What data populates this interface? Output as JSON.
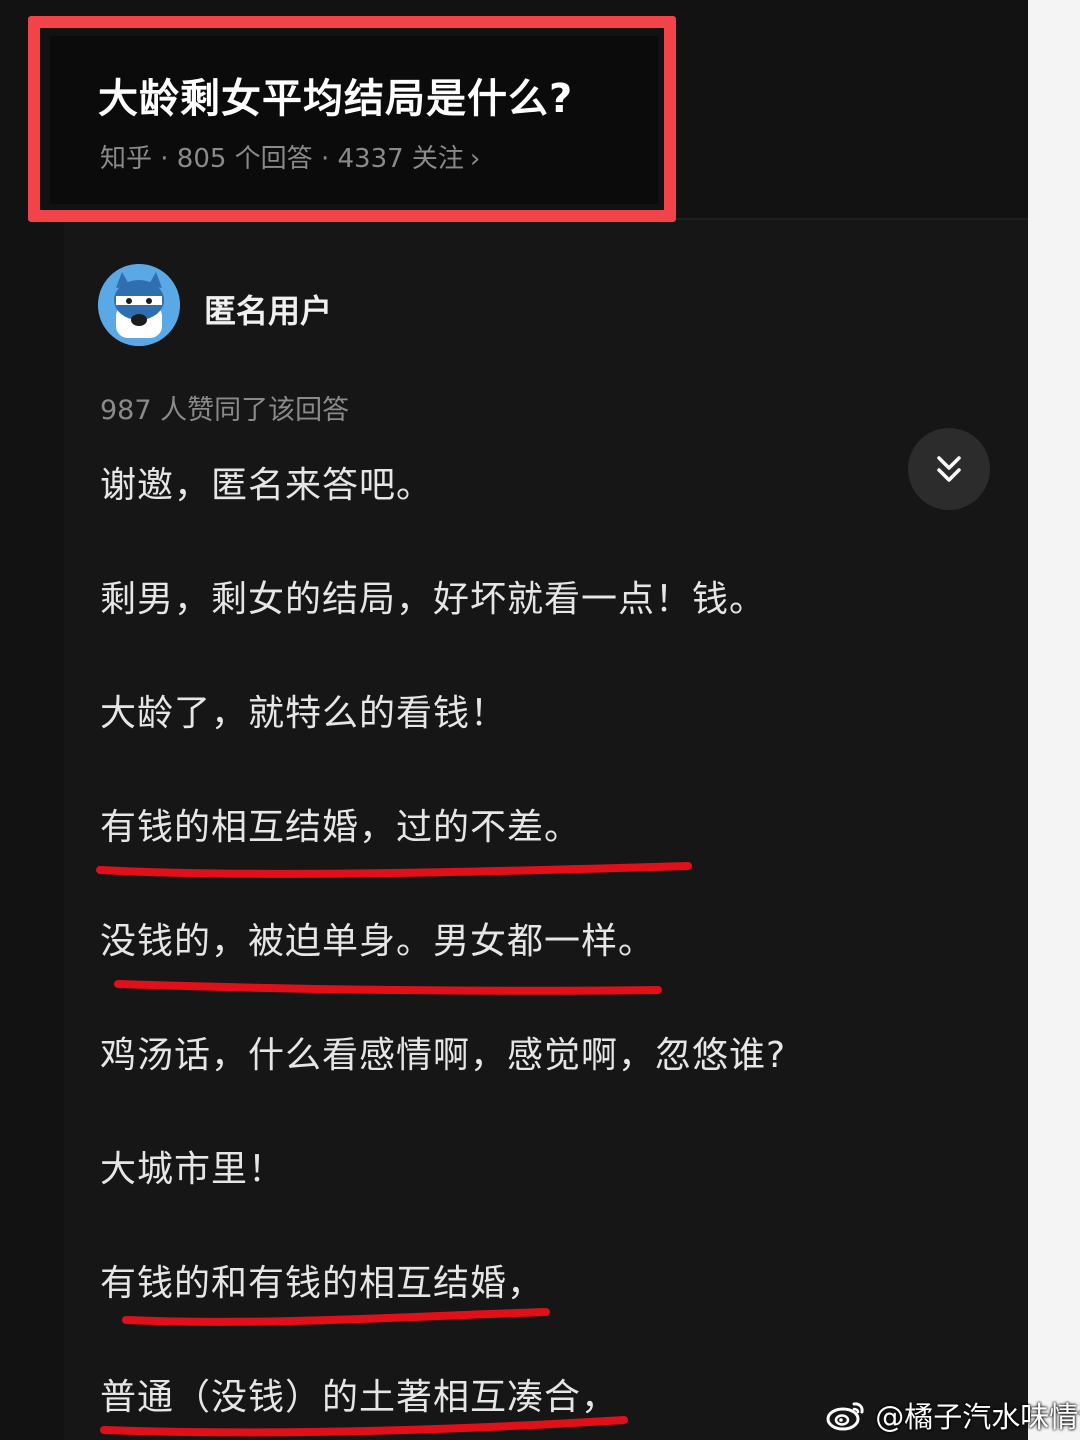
{
  "question": {
    "title": "大龄剩女平均结局是什么?",
    "source": "知乎",
    "answers": "805 个回答",
    "followers": "4337 关注",
    "meta": "知乎 · 805 个回答 · 4337 关注"
  },
  "answer": {
    "author": "匿名用户",
    "votes": "987 人赞同了该回答",
    "paragraphs": [
      "谢邀，匿名来答吧。",
      "剩男，剩女的结局，好坏就看一点！钱。",
      "大龄了，就特么的看钱！",
      "有钱的相互结婚，过的不差。",
      "没钱的，被迫单身。男女都一样。",
      "鸡汤话，什么看感情啊，感觉啊，忽悠谁?",
      "大城市里！",
      "有钱的和有钱的相互结婚，",
      "普通（没钱）的土著相互凑合，"
    ]
  },
  "watermark": {
    "text": "@橘子汽水味情话",
    "icon": "weibo-icon"
  },
  "icons": {
    "collapse": "double-chevron-down-icon",
    "avatar": "anonymous-avatar-icon",
    "meta_chevron": "chevron-right-icon"
  },
  "colors": {
    "background": "#121212",
    "highlight_box": "#f2424a",
    "underline": "#e0101a",
    "text": "#e6e6e6",
    "muted": "#8a8a8a"
  }
}
